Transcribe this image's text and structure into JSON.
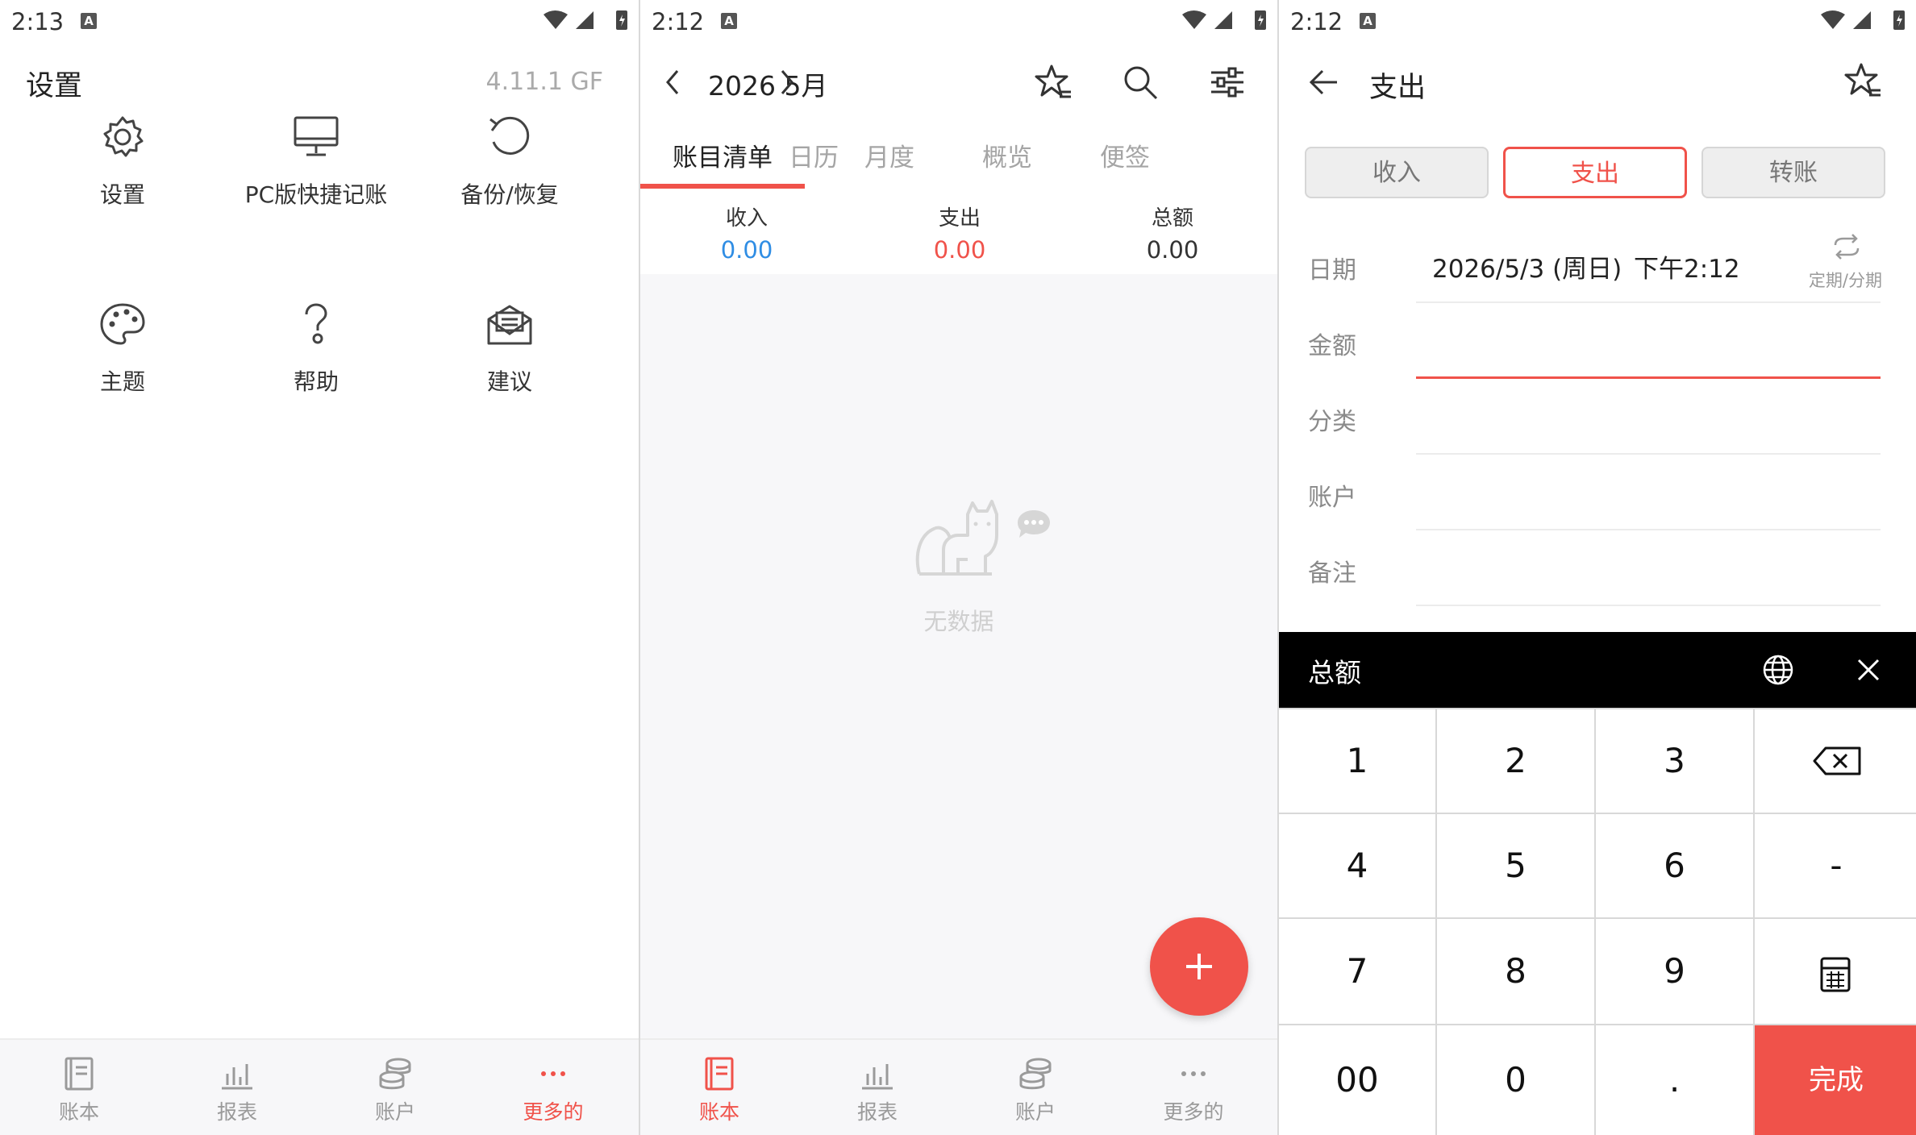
{
  "panel1": {
    "status_time": "2:13",
    "title": "设置",
    "version": "4.11.1 GF",
    "grid": [
      {
        "label": "设置"
      },
      {
        "label": "PC版快捷记账"
      },
      {
        "label": "备份/恢复"
      },
      {
        "label": "主题"
      },
      {
        "label": "帮助"
      },
      {
        "label": "建议"
      }
    ],
    "nav": [
      "账本",
      "报表",
      "账户",
      "更多的"
    ],
    "active_nav": 3
  },
  "panel2": {
    "status_time": "2:12",
    "month": "2026 5月",
    "tabs": [
      "账目清单",
      "日历",
      "月度",
      "概览",
      "便签"
    ],
    "summary": {
      "income_label": "收入",
      "income_value": "0.00",
      "expense_label": "支出",
      "expense_value": "0.00",
      "total_label": "总额",
      "total_value": "0.00"
    },
    "empty_text": "无数据",
    "nav": [
      "账本",
      "报表",
      "账户",
      "更多的"
    ],
    "active_nav": 0
  },
  "panel3": {
    "status_time": "2:12",
    "title": "支出",
    "types": [
      "收入",
      "支出",
      "转账"
    ],
    "selected_type": 1,
    "fields": {
      "date_label": "日期",
      "date_value": "2026/5/3 (周日)",
      "time_value": "下午2:12",
      "recurring_label": "定期/分期",
      "amount_label": "金额",
      "category_label": "分类",
      "account_label": "账户",
      "note_label": "备注"
    },
    "keyboard_title": "总额",
    "keys": [
      "1",
      "2",
      "3",
      "4",
      "5",
      "6",
      "-",
      "7",
      "8",
      "9",
      "00",
      "0",
      ".",
      "完成"
    ]
  },
  "colors": {
    "accent": "#f0524a",
    "income": "#2f8de4",
    "expense": "#f0524a",
    "total": "#333333"
  }
}
